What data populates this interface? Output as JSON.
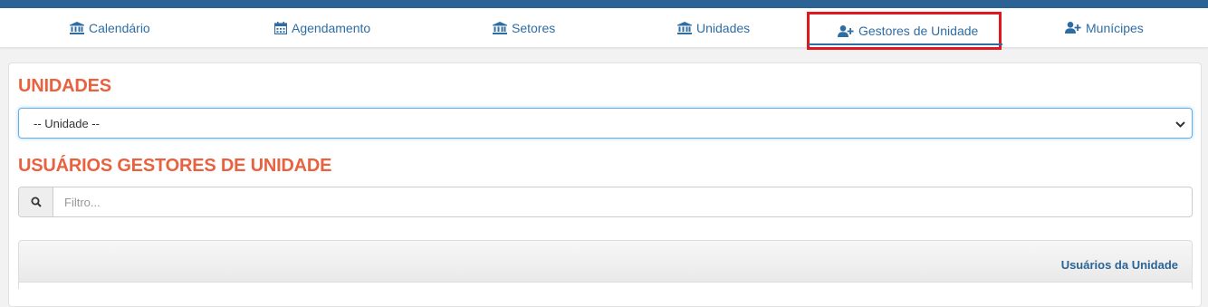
{
  "colors": {
    "topbar": "#2b6494",
    "link": "#2e6da4",
    "heading": "#e8623f",
    "highlight": "#e0171f"
  },
  "nav": {
    "tabs": [
      {
        "label": "Calendário",
        "icon": "bank-icon"
      },
      {
        "label": "Agendamento",
        "icon": "calendar-icon"
      },
      {
        "label": "Setores",
        "icon": "bank-icon"
      },
      {
        "label": "Unidades",
        "icon": "bank-icon"
      },
      {
        "label": "Gestores de Unidade",
        "icon": "user-plus-icon",
        "active": true
      },
      {
        "label": "Munícipes",
        "icon": "user-plus-icon"
      }
    ]
  },
  "unidades": {
    "title": "UNIDADES",
    "select_value": "-- Unidade --"
  },
  "gestores": {
    "title": "USUÁRIOS GESTORES DE UNIDADE",
    "filter_placeholder": "Filtro...",
    "filter_icon": "search-icon",
    "table_header": "Usuários da Unidade"
  }
}
